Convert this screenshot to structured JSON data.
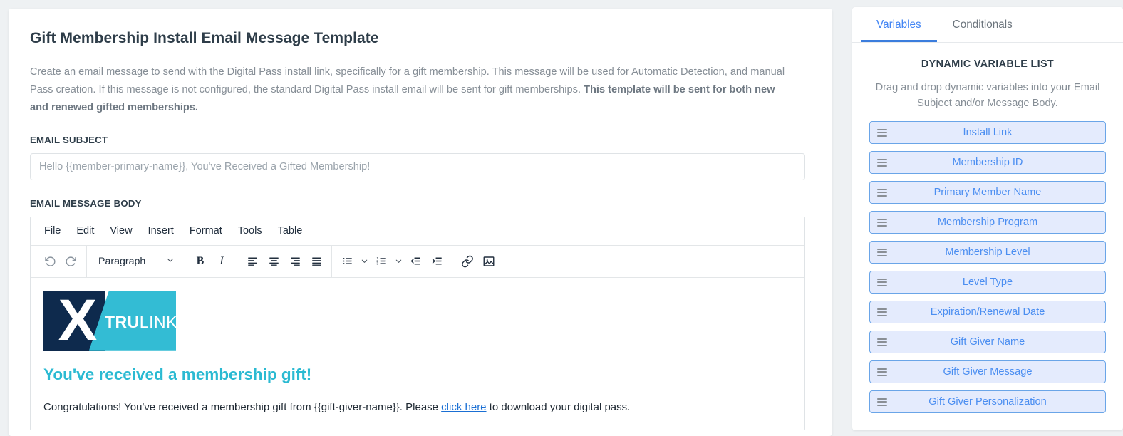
{
  "main": {
    "title": "Gift Membership Install Email Message Template",
    "description_part1": "Create an email message to send with the Digital Pass install link, specifically for a gift membership. This message will be used for Automatic Detection, and manual Pass creation. If this message is not configured, the standard Digital Pass install email will be sent for gift memberships. ",
    "description_bold": "This template will be sent for both new and renewed gifted memberships.",
    "email_subject_label": "EMAIL SUBJECT",
    "email_subject_value": "",
    "email_subject_placeholder": "Hello {{member-primary-name}}, You've Received a Gifted Membership!",
    "email_body_label": "EMAIL MESSAGE BODY"
  },
  "editor": {
    "menus": [
      "File",
      "Edit",
      "View",
      "Insert",
      "Format",
      "Tools",
      "Table"
    ],
    "format_select": "Paragraph",
    "toolbar_icons": [
      "undo-icon",
      "redo-icon",
      "bold-icon",
      "italic-icon",
      "align-left-icon",
      "align-center-icon",
      "align-right-icon",
      "align-justify-icon",
      "bullet-list-icon",
      "numbered-list-icon",
      "outdent-icon",
      "indent-icon",
      "link-icon",
      "image-icon"
    ],
    "bold_label": "B",
    "italic_label": "I",
    "content": {
      "logo_x": "X",
      "logo_tru": "TRU",
      "logo_link": "LINK",
      "heading": "You've received a membership gift!",
      "paragraph_before_link": "Congratulations! You've received a membership gift from {{gift-giver-name}}. Please ",
      "link_text": "click here",
      "paragraph_after_link": " to download your digital pass."
    }
  },
  "sidebar": {
    "tabs": [
      {
        "label": "Variables",
        "active": true
      },
      {
        "label": "Conditionals",
        "active": false
      }
    ],
    "title": "DYNAMIC VARIABLE LIST",
    "description": "Drag and drop dynamic variables into your Email Subject and/or Message Body.",
    "variables": [
      {
        "label": "Install Link"
      },
      {
        "label": "Membership ID"
      },
      {
        "label": "Primary Member Name"
      },
      {
        "label": "Membership Program"
      },
      {
        "label": "Membership Level"
      },
      {
        "label": "Level Type"
      },
      {
        "label": "Expiration/Renewal Date"
      },
      {
        "label": "Gift Giver Name"
      },
      {
        "label": "Gift Giver Message"
      },
      {
        "label": "Gift Giver Personalization"
      }
    ]
  },
  "colors": {
    "accent_blue": "#4285f4",
    "tab_underline": "#3b7ddd",
    "pill_bg": "#e4ebfd",
    "pill_border": "#6aa5e8",
    "pill_text": "#4b8ef1",
    "brand_navy": "#0e2a4d",
    "brand_teal": "#33bcd4",
    "heading_teal": "#2bbad2",
    "page_bg": "#eef1f3",
    "body_text": "#868e96",
    "title_text": "#2e3d49"
  }
}
